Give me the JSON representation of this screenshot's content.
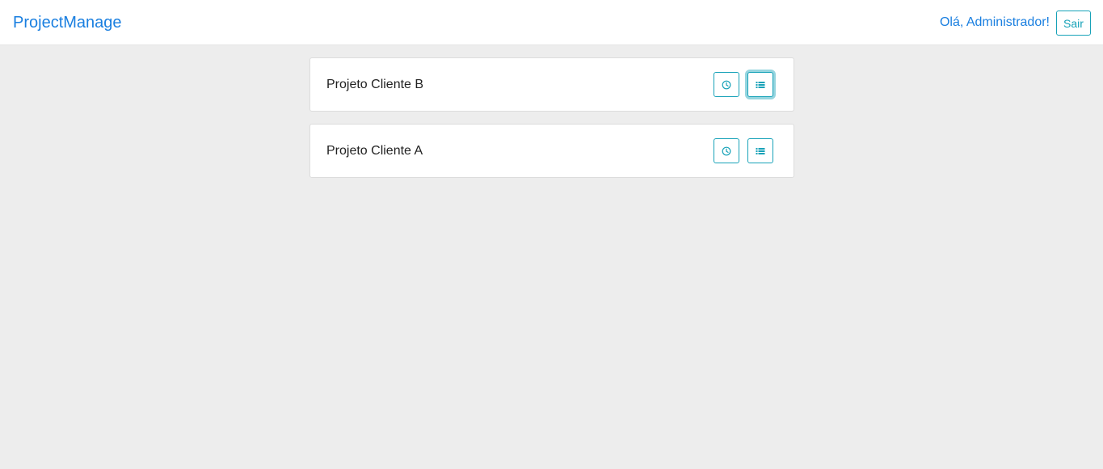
{
  "navbar": {
    "brand": "ProjectManage",
    "greeting": "Olá, Administrador!",
    "logout_label": "Sair"
  },
  "projects": [
    {
      "name": "Projeto Cliente B",
      "time_icon": "clock-icon",
      "tasks_icon": "list-icon"
    },
    {
      "name": "Projeto Cliente A",
      "time_icon": "clock-icon",
      "tasks_icon": "list-icon"
    }
  ],
  "colors": {
    "accent": "#1a7fe0",
    "button_outline": "#17a2b8",
    "background": "#ededed"
  }
}
